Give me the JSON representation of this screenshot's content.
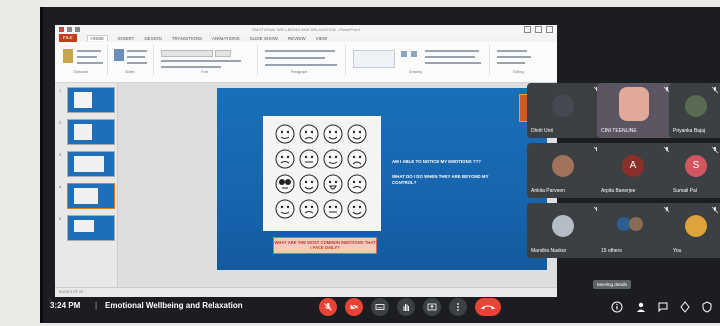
{
  "ppt": {
    "window_title": "EMOTIONAL WELLBEING AND RELAXATION - PowerPoint",
    "tabs": [
      "FILE",
      "HOME",
      "INSERT",
      "DESIGN",
      "TRANSITIONS",
      "ANIMATIONS",
      "SLIDE SHOW",
      "REVIEW",
      "VIEW"
    ],
    "active_tab": "HOME",
    "ribbon_groups": [
      "Clipboard",
      "Slides",
      "Font",
      "Paragraph",
      "Drawing",
      "Editing"
    ],
    "slide_numbers": [
      "1",
      "2",
      "3",
      "4",
      "5"
    ],
    "status": "SLIDE 5 OF 23",
    "slide": {
      "question1": "AM I ABLE TO NOTICE MY EMOTIONS ???",
      "question2": "WHAT DO I DO WHEN THEY ARE BEYOND MY CONTROL?",
      "caption": "WHAT ARE THE MOST COMMON EMOTIONS THAT I FACE DAILY?"
    }
  },
  "participants": [
    {
      "name": "Dhriti Unit",
      "kind": "photo",
      "color": "#444a50"
    },
    {
      "name": "CINI TEENLINE",
      "kind": "video",
      "color": "#6d5f78"
    },
    {
      "name": "Priyanka Bajaj",
      "kind": "photo",
      "color": "#40464c"
    },
    {
      "name": "Ankita Parveen",
      "kind": "photo",
      "color": "#a1735a"
    },
    {
      "name": "Arpita Banerjee",
      "kind": "letter",
      "letter": "A",
      "color": "#8c2e2a"
    },
    {
      "name": "Sumali Pal",
      "kind": "letter",
      "letter": "S",
      "color": "#d25660"
    },
    {
      "name": "Mandira Naskar",
      "kind": "photo",
      "color": "#b5bcc4"
    },
    {
      "name": "15 others",
      "kind": "group",
      "color": "#2d5f92"
    },
    {
      "name": "You",
      "kind": "photo",
      "color": "#e0a23a"
    }
  ],
  "meeting": {
    "time": "3:24 PM",
    "separator": "|",
    "title": "Emotional Wellbeing and Relaxation",
    "tooltip": "Meeting details"
  },
  "controls": [
    "mic-off-icon",
    "camera-off-icon",
    "captions-icon",
    "raise-hand-icon",
    "present-icon",
    "more-options-icon",
    "end-call-icon"
  ],
  "right_controls": [
    "info-icon",
    "people-icon",
    "chat-icon",
    "activities-icon",
    "host-controls-icon"
  ],
  "colors": {
    "slide_blue": "#1a6fb9",
    "end_call": "#ea4335",
    "tile": "#3c4043"
  }
}
